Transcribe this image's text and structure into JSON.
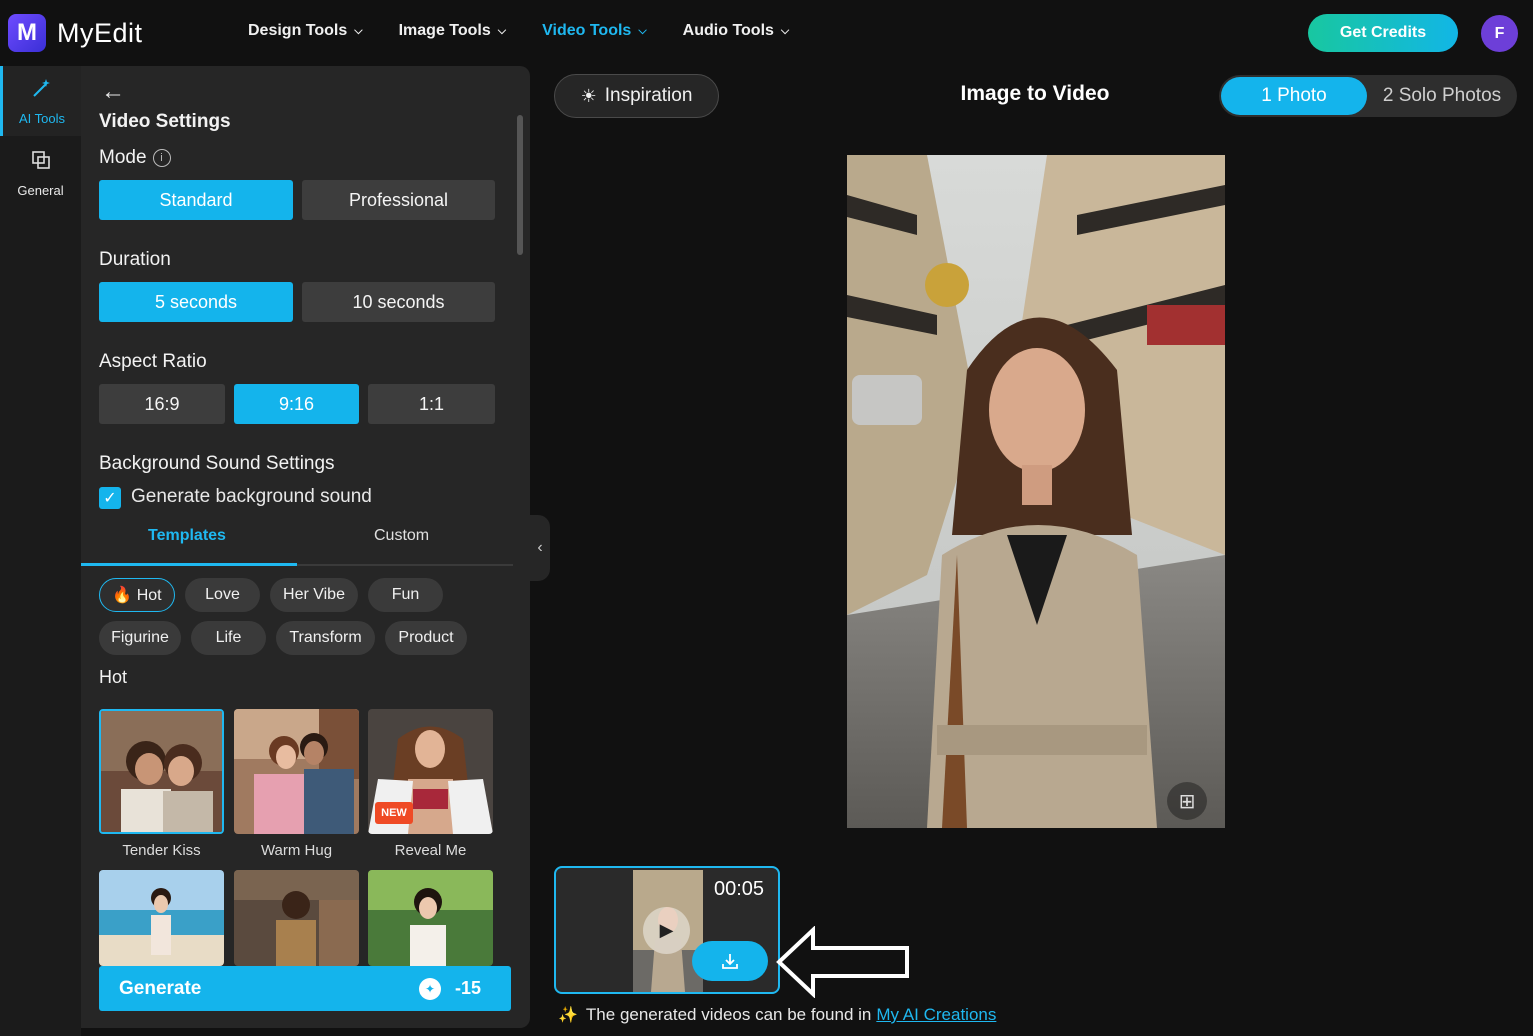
{
  "header": {
    "logo_letter": "M",
    "app_name": "MyEdit",
    "nav": [
      {
        "label": "Design Tools"
      },
      {
        "label": "Image Tools"
      },
      {
        "label": "Video Tools"
      },
      {
        "label": "Audio Tools"
      }
    ],
    "active_nav": "Video Tools",
    "get_credits": "Get Credits",
    "avatar_initial": "F"
  },
  "rail": {
    "items": [
      {
        "label": "AI Tools",
        "icon": "magic-wand-icon",
        "active": true
      },
      {
        "label": "General",
        "icon": "layers-icon",
        "active": false
      }
    ]
  },
  "settings": {
    "title": "Video Settings",
    "mode": {
      "label": "Mode",
      "options": [
        "Standard",
        "Professional"
      ],
      "selected": "Standard"
    },
    "duration": {
      "label": "Duration",
      "options": [
        "5 seconds",
        "10 seconds"
      ],
      "selected": "5 seconds"
    },
    "aspect": {
      "label": "Aspect Ratio",
      "options": [
        "16:9",
        "9:16",
        "1:1"
      ],
      "selected": "9:16"
    },
    "sound": {
      "label": "Background Sound Settings",
      "checkbox": "Generate background sound",
      "checked": true
    },
    "tabs": [
      "Templates",
      "Custom"
    ],
    "active_tab": "Templates",
    "chips_row1": [
      "🔥 Hot",
      "Love",
      "Her Vibe",
      "Fun"
    ],
    "chips_row2": [
      "Figurine",
      "Life",
      "Transform",
      "Product"
    ],
    "selected_chip": "🔥 Hot",
    "section": "Hot",
    "templates": [
      {
        "label": "Tender Kiss",
        "selected": true
      },
      {
        "label": "Warm Hug",
        "selected": false
      },
      {
        "label": "Reveal Me",
        "badge": "NEW"
      }
    ],
    "generate": {
      "label": "Generate",
      "cost": "-15"
    }
  },
  "main": {
    "inspiration": "Inspiration",
    "title": "Image to Video",
    "photo_modes": [
      "1 Photo",
      "2 Solo Photos"
    ],
    "selected_photo_mode": "1 Photo",
    "result": {
      "duration": "00:05"
    },
    "footnote": "The generated videos can be found in",
    "footnote_link": "My AI Creations"
  },
  "colors": {
    "accent": "#14b4ec",
    "background": "#111111",
    "panel": "#262626"
  }
}
